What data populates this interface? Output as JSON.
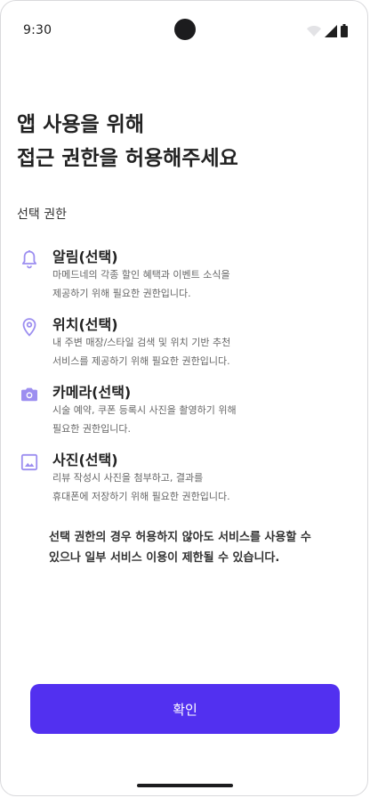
{
  "status_bar": {
    "time": "9:30"
  },
  "title_lines": [
    "앱 사용을 위해",
    "접근 권한을 허용해주세요"
  ],
  "section_label": "선택 권한",
  "permissions": [
    {
      "icon": "bell-icon",
      "title": "알림(선택)",
      "desc": [
        "마메드네의 각종 할인 혜택과 이벤트 소식을",
        "제공하기 위해 필요한 권한입니다."
      ]
    },
    {
      "icon": "location-pin-icon",
      "title": "위치(선택)",
      "desc": [
        "내 주변 매장/스타일 검색 및 위치 기반 추천",
        "서비스를 제공하기 위해 필요한 권한입니다."
      ]
    },
    {
      "icon": "camera-icon",
      "title": "카메라(선택)",
      "desc": [
        "시술 예약, 쿠폰 등록시 사진을 촬영하기 위해",
        "필요한 권한입니다."
      ]
    },
    {
      "icon": "image-icon",
      "title": "사진(선택)",
      "desc": [
        "리뷰 작성시 사진을 첨부하고, 결과를",
        "휴대폰에 저장하기 위해 필요한 권한입니다."
      ]
    }
  ],
  "notice_lines": [
    "선택 권한의 경우 허용하지 않아도 서비스를 사용할 수",
    "있으나 일부 서비스 이용이 제한될 수 있습니다."
  ],
  "confirm_label": "확인",
  "colors": {
    "accent": "#5230f0",
    "icon": "#9c8ef0"
  }
}
